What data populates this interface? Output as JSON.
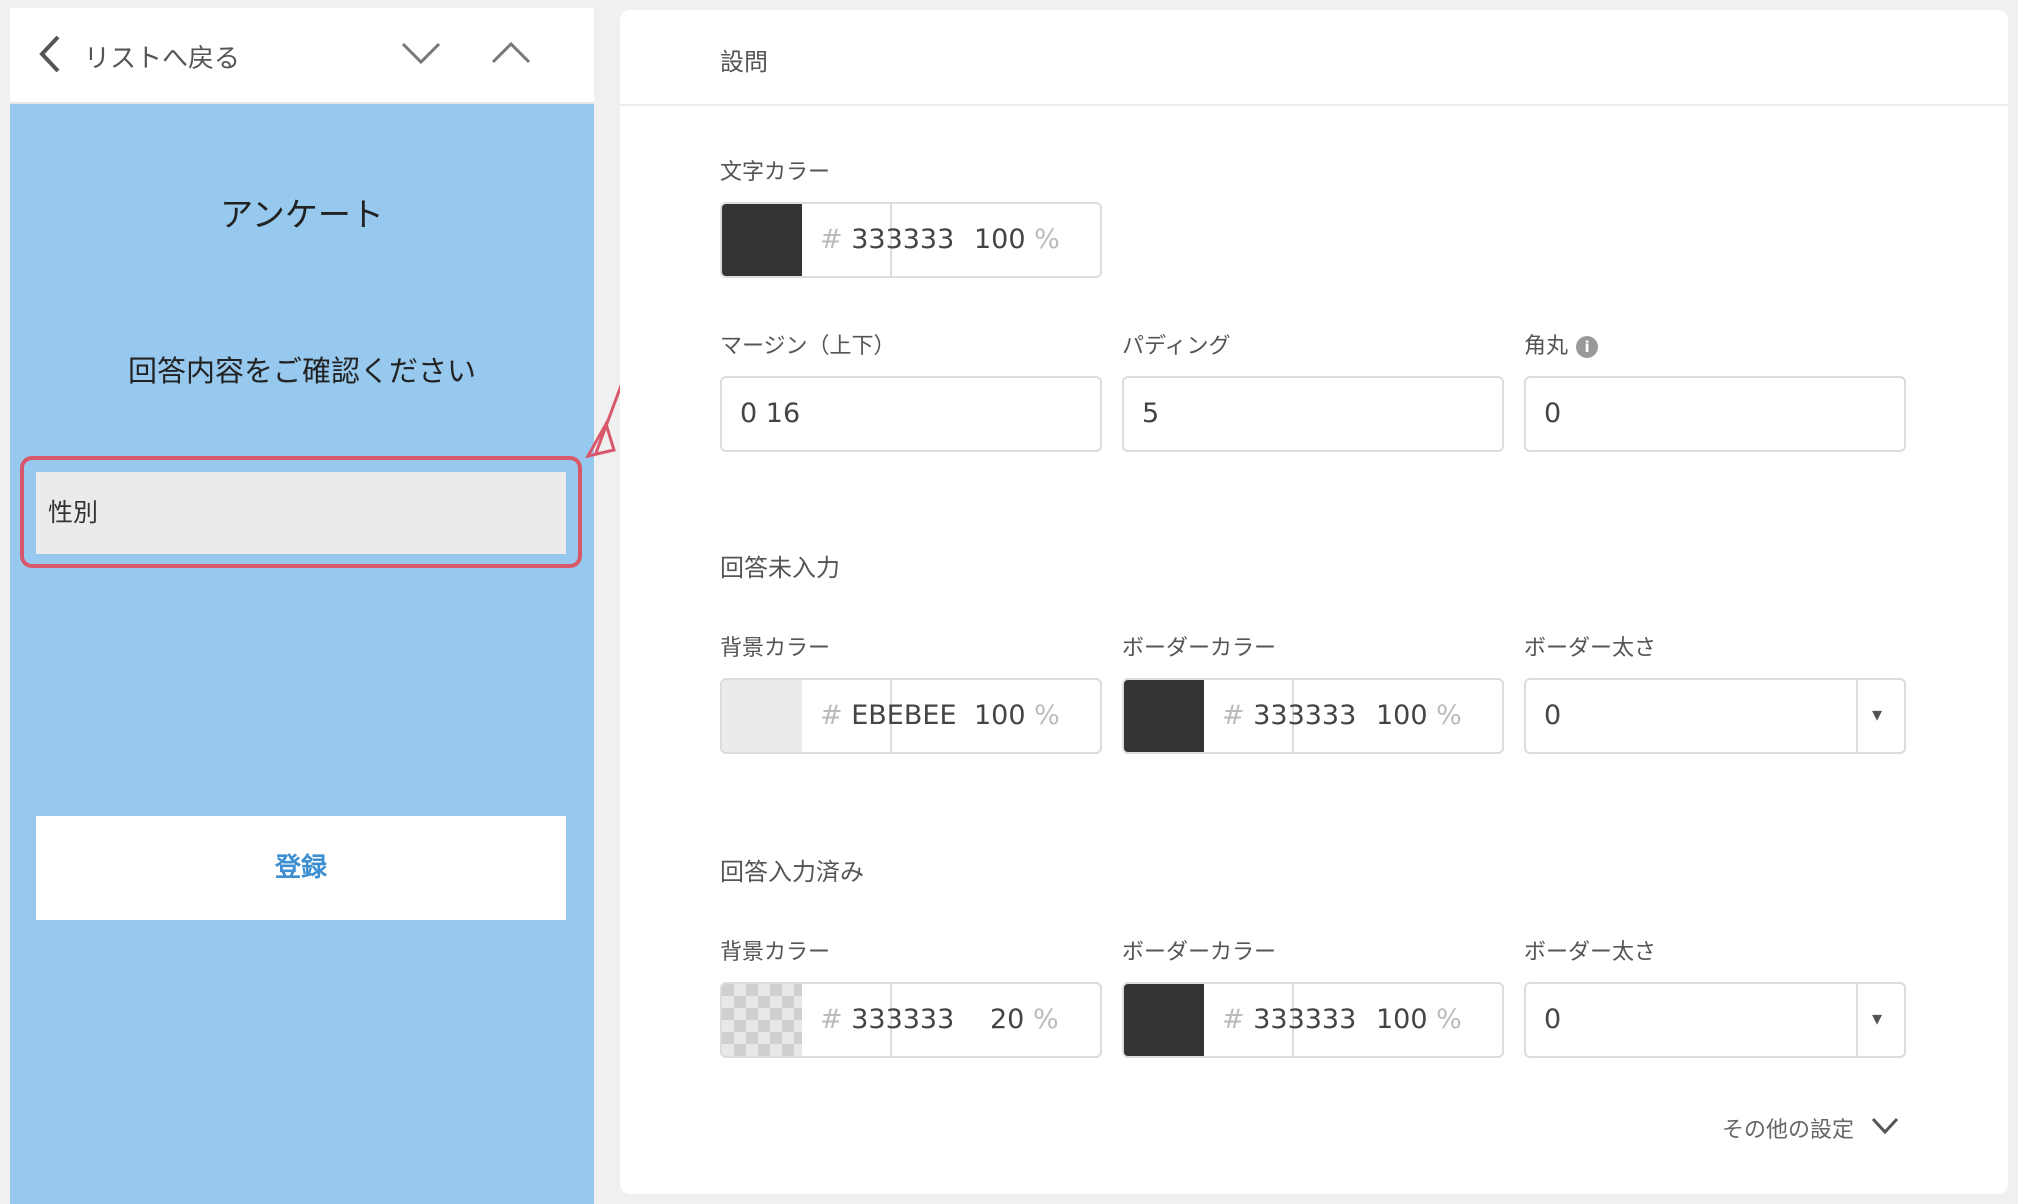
{
  "left_panel": {
    "back_label": "リストへ戻る",
    "survey_title": "アンケート",
    "confirm_text": "回答内容をご確認ください",
    "field_label": "性別",
    "register_label": "登録"
  },
  "right_panel": {
    "header": "設問",
    "text_color": {
      "label": "文字カラー",
      "hash": "#",
      "hex": "333333",
      "opacity": "100",
      "pct": "%",
      "swatch_color": "#333333"
    },
    "margin": {
      "label": "マージン（上下）",
      "value": "0 16"
    },
    "padding": {
      "label": "パディング",
      "value": "5"
    },
    "radius": {
      "label": "角丸",
      "info": "i",
      "value": "0"
    },
    "unanswered": {
      "title": "回答未入力",
      "bg": {
        "label": "背景カラー",
        "hash": "#",
        "hex": "EBEBEE",
        "opacity": "100",
        "pct": "%",
        "swatch_color": "#ebebeb"
      },
      "border_color": {
        "label": "ボーダーカラー",
        "hash": "#",
        "hex": "333333",
        "opacity": "100",
        "pct": "%",
        "swatch_color": "#333333"
      },
      "border_width": {
        "label": "ボーダー太さ",
        "value": "0",
        "arrow": "▾"
      }
    },
    "answered": {
      "title": "回答入力済み",
      "bg": {
        "label": "背景カラー",
        "hash": "#",
        "hex": "333333",
        "opacity": "20",
        "pct": "%",
        "swatch_color": "#333333"
      },
      "border_color": {
        "label": "ボーダーカラー",
        "hash": "#",
        "hex": "333333",
        "opacity": "100",
        "pct": "%",
        "swatch_color": "#333333"
      },
      "border_width": {
        "label": "ボーダー太さ",
        "value": "0",
        "arrow": "▾"
      }
    },
    "other_settings": "その他の設定"
  },
  "colors": {
    "preview_bg": "#97c9ee",
    "highlight": "#d9576a",
    "accent_blue": "#3d8fd1"
  },
  "icons": [
    "chevron-left-icon",
    "chevron-down-icon",
    "chevron-up-icon",
    "info-icon",
    "dropdown-arrow-icon"
  ]
}
